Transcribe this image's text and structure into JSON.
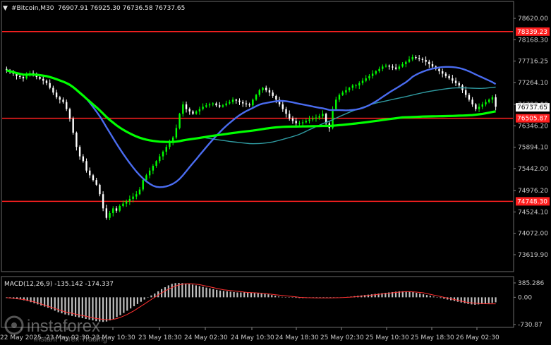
{
  "header": {
    "symbol_label": "#Bitcoin,M30",
    "ohlc": "76907.91 76925.30 76736.58 76737.65",
    "macd_label": "MACD(12,26,9) -135.142 -174.337"
  },
  "watermark": {
    "text": "instaforex",
    "subtext": "Instant Forex Trading"
  },
  "colors": {
    "background": "#000000",
    "bull_candle": "#00ff00",
    "bear_candle": "#ffffff",
    "ma_fast": "#00ff00",
    "ma_mid": "#4a6cf0",
    "ma_slow": "#2f9aa0",
    "level_line": "#ff2020",
    "macd_hist": "#c0c0c0",
    "macd_signal": "#ff3030"
  },
  "chart_data": {
    "type": "candlestick",
    "price_axis": {
      "ticks": [
        "78620.00",
        "78168.30",
        "77716.25",
        "77264.10",
        "76798.00",
        "76346.20",
        "75894.10",
        "75442.00",
        "74976.20",
        "74524.10",
        "74072.00",
        "73619.90"
      ],
      "ylim": [
        73619.9,
        78800
      ]
    },
    "x_axis": {
      "labels": [
        "22 May 2025",
        "23 May 02:30",
        "23 May 10:30",
        "23 May 18:30",
        "24 May 02:30",
        "24 May 10:30",
        "24 May 18:30",
        "25 May 02:30",
        "25 May 10:30",
        "25 May 18:30",
        "26 May 02:30"
      ]
    },
    "levels": [
      {
        "price": 78339.23,
        "label": "78339.23"
      },
      {
        "price": 76505.87,
        "label": "76505.87"
      },
      {
        "price": 74748.3,
        "label": "74748.30"
      }
    ],
    "current_price": {
      "price": 76737.65,
      "label": "76737.65"
    },
    "closes": [
      77520,
      77480,
      77450,
      77400,
      77380,
      77350,
      77420,
      77460,
      77420,
      77380,
      77340,
      77300,
      77250,
      77150,
      77050,
      76950,
      76900,
      76850,
      76700,
      76500,
      76200,
      75900,
      75700,
      75600,
      75400,
      75300,
      75200,
      75100,
      74900,
      74600,
      74400,
      74500,
      74600,
      74550,
      74650,
      74700,
      74750,
      74800,
      74850,
      74900,
      75000,
      75200,
      75300,
      75400,
      75500,
      75600,
      75700,
      75800,
      75900,
      76000,
      76100,
      76300,
      76600,
      76800,
      76700,
      76650,
      76600,
      76650,
      76700,
      76750,
      76780,
      76800,
      76820,
      76780,
      76750,
      76780,
      76820,
      76850,
      76900,
      76880,
      76850,
      76820,
      76800,
      76780,
      76900,
      77000,
      77100,
      77150,
      77100,
      77050,
      76980,
      76900,
      76800,
      76700,
      76600,
      76500,
      76450,
      76400,
      76400,
      76420,
      76450,
      76480,
      76500,
      76520,
      76550,
      76600,
      76400,
      76300,
      76700,
      76900,
      77000,
      77050,
      77100,
      77150,
      77200,
      77200,
      77250,
      77300,
      77350,
      77400,
      77450,
      77500,
      77550,
      77600,
      77620,
      77600,
      77580,
      77550,
      77600,
      77650,
      77700,
      77750,
      77800,
      77780,
      77760,
      77740,
      77700,
      77650,
      77600,
      77550,
      77500,
      77450,
      77400,
      77350,
      77300,
      77250,
      77200,
      77100,
      77000,
      76900,
      76800,
      76700,
      76750,
      76800,
      76850,
      76900,
      76950,
      76750
    ]
  },
  "macd": {
    "ticks": [
      "385.286",
      "0.00",
      "-730.87"
    ],
    "hist": [
      -20,
      -30,
      -40,
      -50,
      -60,
      -80,
      -100,
      -130,
      -160,
      -190,
      -220,
      -250,
      -280,
      -320,
      -360,
      -400,
      -430,
      -460,
      -480,
      -500,
      -520,
      -540,
      -560,
      -580,
      -600,
      -620,
      -640,
      -650,
      -660,
      -650,
      -620,
      -580,
      -530,
      -480,
      -420,
      -360,
      -300,
      -240,
      -180,
      -120,
      -60,
      0,
      50,
      100,
      160,
      220,
      270,
      320,
      360,
      380,
      385,
      380,
      370,
      360,
      340,
      320,
      300,
      280,
      260,
      240,
      220,
      200,
      180,
      170,
      160,
      150,
      140,
      130,
      130,
      130,
      130,
      130,
      120,
      110,
      100,
      90,
      80,
      60,
      40,
      20,
      10,
      0,
      -5,
      -10,
      -15,
      -20,
      -20,
      -20,
      -20,
      -20,
      -20,
      -20,
      -20,
      -20,
      -20,
      -20,
      -15,
      -10,
      0,
      10,
      20,
      30,
      40,
      50,
      60,
      70,
      80,
      90,
      100,
      110,
      120,
      130,
      140,
      150,
      160,
      160,
      160,
      150,
      140,
      120,
      100,
      80,
      60,
      40,
      20,
      0,
      -20,
      -40,
      -60,
      -80,
      -100,
      -120,
      -140,
      -160,
      -180,
      -190,
      -200,
      -190,
      -180,
      -170,
      -160,
      -150,
      -135
    ],
    "signal": [
      -10,
      -20,
      -30,
      -40,
      -50,
      -60,
      -80,
      -100,
      -120,
      -150,
      -180,
      -210,
      -240,
      -270,
      -300,
      -330,
      -360,
      -390,
      -410,
      -430,
      -450,
      -470,
      -490,
      -510,
      -530,
      -550,
      -570,
      -580,
      -590,
      -600,
      -600,
      -590,
      -570,
      -540,
      -500,
      -460,
      -410,
      -360,
      -300,
      -240,
      -180,
      -120,
      -60,
      0,
      60,
      120,
      170,
      220,
      260,
      300,
      330,
      350,
      360,
      365,
      360,
      350,
      340,
      320,
      300,
      280,
      260,
      240,
      220,
      200,
      190,
      180,
      170,
      160,
      150,
      140,
      130,
      125,
      120,
      115,
      110,
      100,
      90,
      80,
      70,
      60,
      50,
      40,
      30,
      20,
      10,
      0,
      -5,
      -10,
      -12,
      -14,
      -15,
      -15,
      -15,
      -15,
      -15,
      -14,
      -12,
      -10,
      -5,
      0,
      5,
      10,
      20,
      30,
      40,
      50,
      60,
      70,
      80,
      90,
      100,
      110,
      120,
      130,
      140,
      145,
      150,
      150,
      145,
      140,
      130,
      120,
      100,
      80,
      60,
      40,
      20,
      0,
      -20,
      -40,
      -60,
      -80,
      -100,
      -120,
      -140,
      -150,
      -160,
      -165,
      -170,
      -172,
      -174,
      -174,
      -174
    ]
  }
}
